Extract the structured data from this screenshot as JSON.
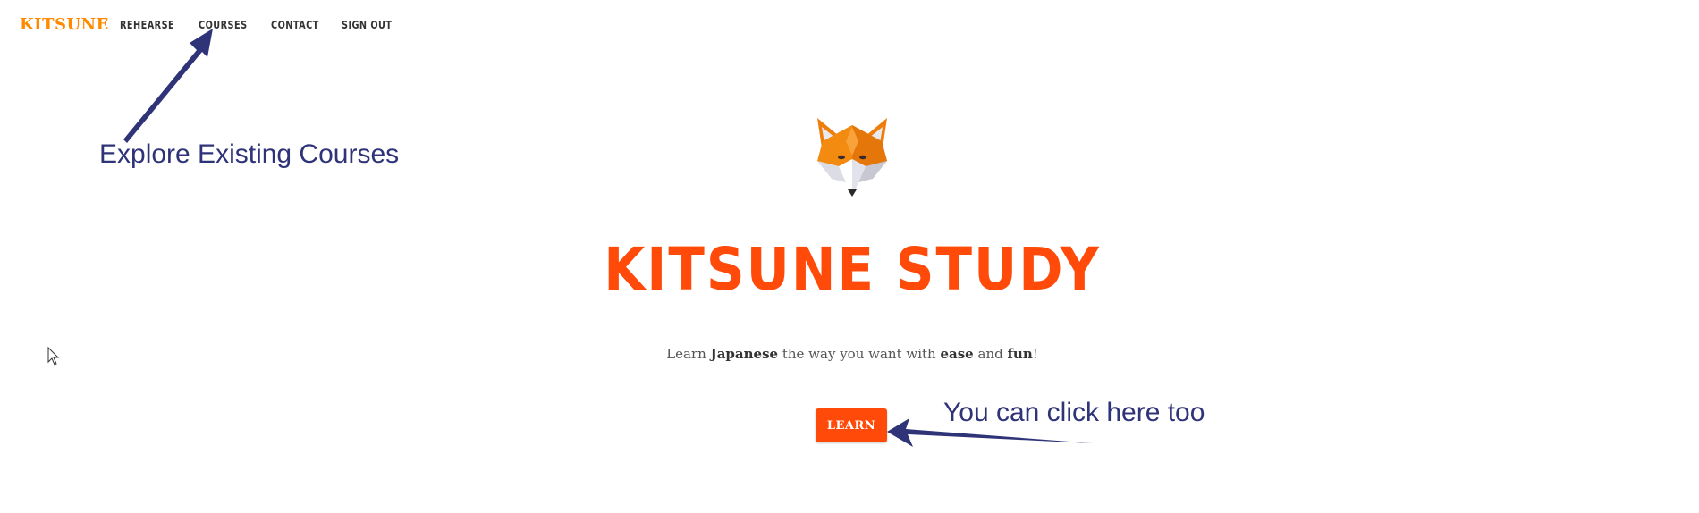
{
  "nav": {
    "logo": "KITSUNE",
    "items": [
      {
        "label": "REHEARSE"
      },
      {
        "label": "COURSES"
      },
      {
        "label": "CONTACT"
      },
      {
        "label": "SIGN OUT"
      }
    ]
  },
  "hero": {
    "icon": "fox-icon",
    "title": "KITSUNE STUDY",
    "subtitle_parts": {
      "p1": "Learn ",
      "b1": "Japanese",
      "p2": " the way you want with ",
      "b2": "ease",
      "p3": " and ",
      "b3": "fun",
      "p4": "!"
    },
    "button_label": "LEARN"
  },
  "annotations": {
    "courses": "Explore Existing Courses",
    "learn": "You can click here too"
  },
  "colors": {
    "accent": "#ff4a0a",
    "logo": "#ff8a00",
    "annotation": "#2f3478"
  }
}
